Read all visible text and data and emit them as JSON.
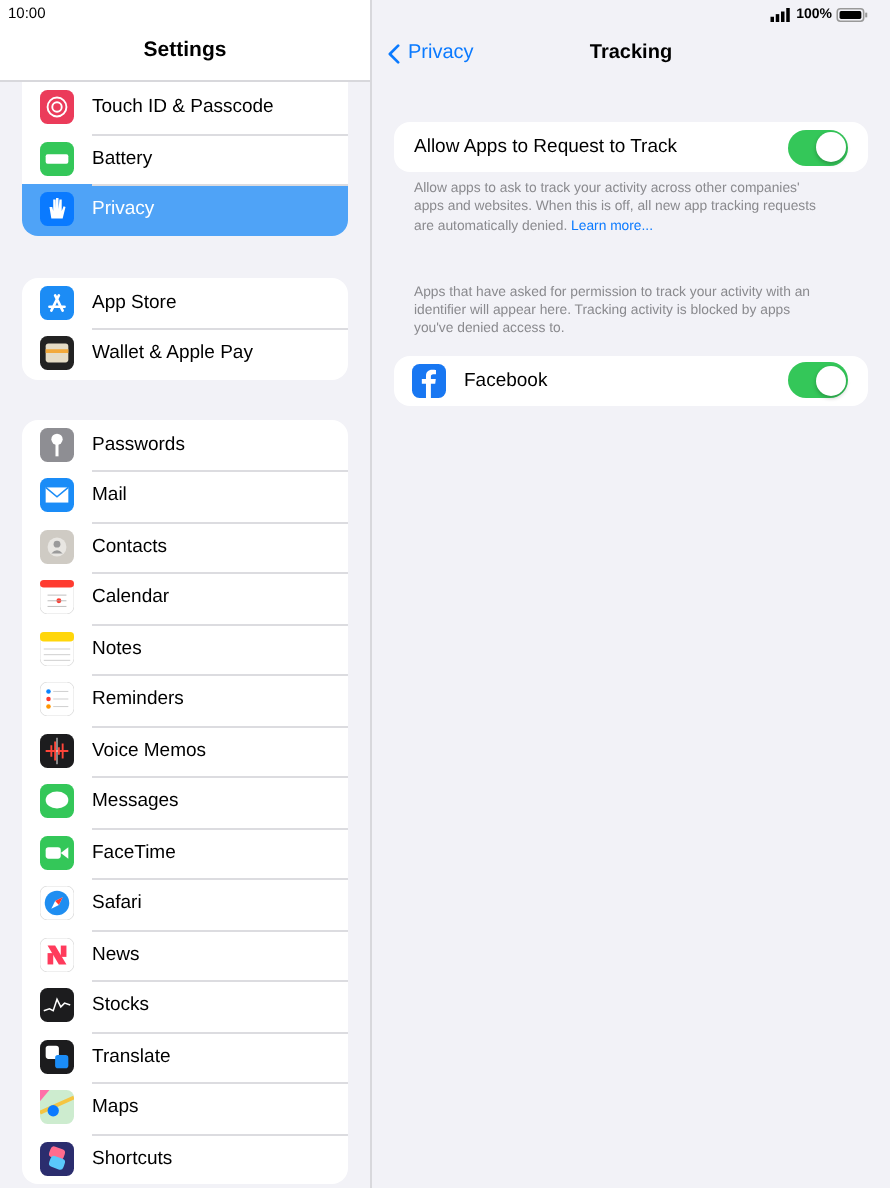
{
  "status_bar": {
    "time": "10:00",
    "battery": "100%"
  },
  "sidebar": {
    "title": "Settings",
    "groups": [
      [
        {
          "label": "Touch ID & Passcode",
          "selected": false
        },
        {
          "label": "Battery",
          "selected": false
        },
        {
          "label": "Privacy",
          "selected": true
        }
      ],
      [
        {
          "label": "App Store",
          "selected": false
        },
        {
          "label": "Wallet & Apple Pay",
          "selected": false
        }
      ],
      [
        {
          "label": "Passwords",
          "selected": false
        },
        {
          "label": "Mail",
          "selected": false
        },
        {
          "label": "Contacts",
          "selected": false
        },
        {
          "label": "Calendar",
          "selected": false
        },
        {
          "label": "Notes",
          "selected": false
        },
        {
          "label": "Reminders",
          "selected": false
        },
        {
          "label": "Voice Memos",
          "selected": false
        },
        {
          "label": "Messages",
          "selected": false
        },
        {
          "label": "FaceTime",
          "selected": false
        },
        {
          "label": "Safari",
          "selected": false
        },
        {
          "label": "News",
          "selected": false
        },
        {
          "label": "Stocks",
          "selected": false
        },
        {
          "label": "Translate",
          "selected": false
        },
        {
          "label": "Maps",
          "selected": false
        },
        {
          "label": "Shortcuts",
          "selected": false
        }
      ]
    ]
  },
  "detail": {
    "back": "Privacy",
    "title": "Tracking",
    "allow_row": {
      "label": "Allow Apps to Request to Track",
      "on": true
    },
    "allow_footer": "Allow apps to ask to track your activity across other companies' apps and websites. When this is off, all new app tracking requests are automatically denied.",
    "learn_more": "Learn more...",
    "apps_header": "Apps that have asked for permission to track your activity with an identifier will appear here. Tracking activity is blocked by apps you've denied access to.",
    "apps": [
      {
        "label": "Facebook",
        "on": true
      }
    ]
  }
}
